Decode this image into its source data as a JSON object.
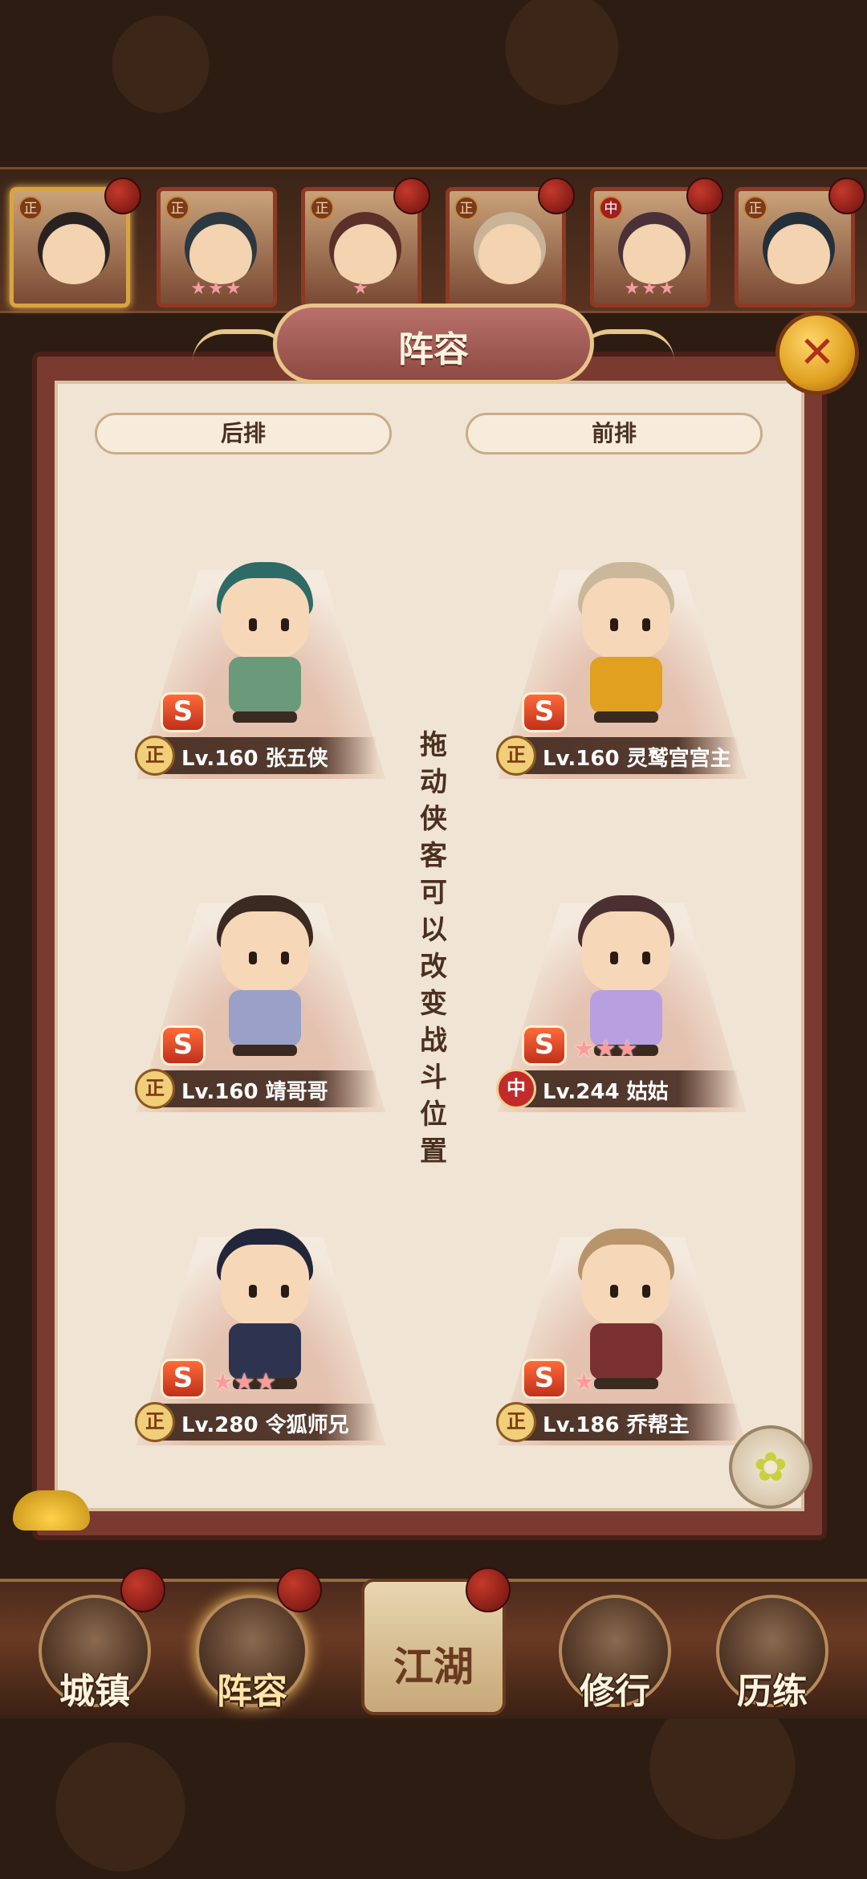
{
  "panel": {
    "title": "阵容",
    "back_row_label": "后排",
    "front_row_label": "前排",
    "hint": "拖动侠客可以改变战斗位置"
  },
  "roster": [
    {
      "tag": "正",
      "stars": ""
    },
    {
      "tag": "正",
      "stars": "★★★"
    },
    {
      "tag": "正",
      "stars": "★"
    },
    {
      "tag": "正",
      "stars": ""
    },
    {
      "tag": "中",
      "stars": "★★★"
    },
    {
      "tag": "正",
      "stars": ""
    }
  ],
  "heroes": {
    "back_1": {
      "faction": "正",
      "level": "Lv.160",
      "name": "张五侠",
      "stars": ""
    },
    "back_2": {
      "faction": "正",
      "level": "Lv.160",
      "name": "靖哥哥",
      "stars": ""
    },
    "back_3": {
      "faction": "正",
      "level": "Lv.280",
      "name": "令狐师兄",
      "stars": "★★★"
    },
    "front_1": {
      "faction": "正",
      "level": "Lv.160",
      "name": "灵鹫宫宫主",
      "stars": ""
    },
    "front_2": {
      "faction": "中",
      "level": "Lv.244",
      "name": "姑姑",
      "stars": "★★★"
    },
    "front_3": {
      "faction": "正",
      "level": "Lv.186",
      "name": "乔帮主",
      "stars": "★"
    }
  },
  "rank_badge": "S",
  "close_icon_glyph": "✕",
  "nav": {
    "town": "城镇",
    "lineup": "阵容",
    "jianghu": "江湖",
    "cultivate": "修行",
    "train": "历练"
  },
  "colors": {
    "panel_frame": "#7a3a30",
    "panel_bg": "#f0e4d4",
    "accent_gold": "#e8c58a",
    "badge_red": "#c0301a"
  }
}
